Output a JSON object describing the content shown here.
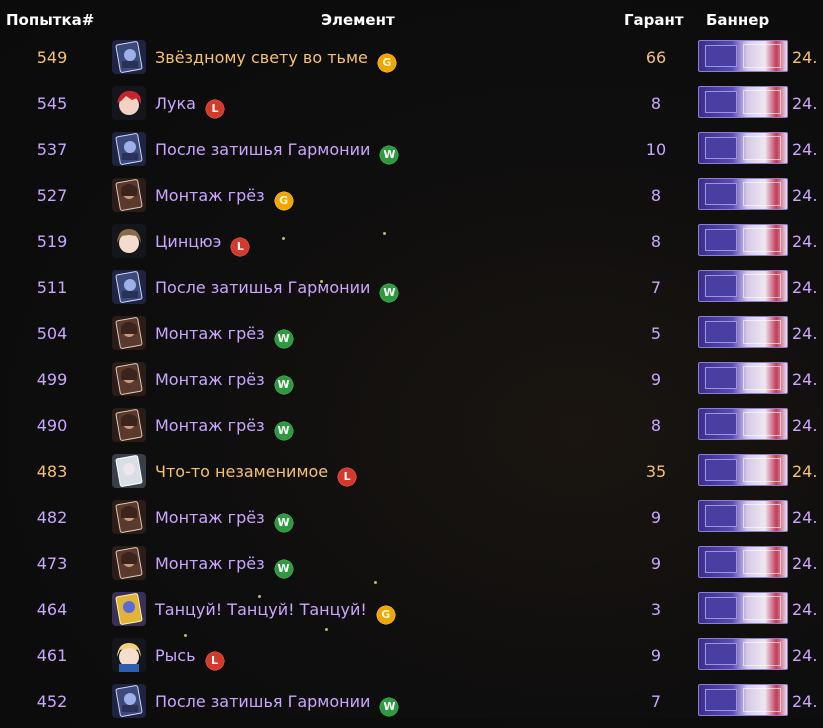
{
  "header": {
    "attempt": "Попытка#",
    "item": "Элемент",
    "pity": "Гарант",
    "banner": "Баннер"
  },
  "rows": [
    {
      "attempt": "549",
      "name": "Звёздному свету во тьме",
      "badge": "G",
      "pity": "66",
      "date": "24.",
      "rarity": "gold",
      "avatar": "lightcone"
    },
    {
      "attempt": "545",
      "name": "Лука",
      "badge": "L",
      "pity": "8",
      "date": "24.",
      "rarity": "purple",
      "avatar": "char-redhair"
    },
    {
      "attempt": "537",
      "name": "После затишья Гармонии",
      "badge": "W",
      "pity": "10",
      "date": "24.",
      "rarity": "purple",
      "avatar": "lightcone"
    },
    {
      "attempt": "527",
      "name": "Монтаж грёз",
      "badge": "G",
      "pity": "8",
      "date": "24.",
      "rarity": "purple",
      "avatar": "lightcone-dark"
    },
    {
      "attempt": "519",
      "name": "Цинцюэ",
      "badge": "L",
      "pity": "8",
      "date": "24.",
      "rarity": "purple",
      "avatar": "char-brown"
    },
    {
      "attempt": "511",
      "name": "После затишья Гармонии",
      "badge": "W",
      "pity": "7",
      "date": "24.",
      "rarity": "purple",
      "avatar": "lightcone"
    },
    {
      "attempt": "504",
      "name": "Монтаж грёз",
      "badge": "W",
      "pity": "5",
      "date": "24.",
      "rarity": "purple",
      "avatar": "lightcone-dark"
    },
    {
      "attempt": "499",
      "name": "Монтаж грёз",
      "badge": "W",
      "pity": "9",
      "date": "24.",
      "rarity": "purple",
      "avatar": "lightcone-dark"
    },
    {
      "attempt": "490",
      "name": "Монтаж грёз",
      "badge": "W",
      "pity": "8",
      "date": "24.",
      "rarity": "purple",
      "avatar": "lightcone-dark"
    },
    {
      "attempt": "483",
      "name": "Что-то незаменимое",
      "badge": "L",
      "pity": "35",
      "date": "24.",
      "rarity": "gold",
      "avatar": "lightcone-light"
    },
    {
      "attempt": "482",
      "name": "Монтаж грёз",
      "badge": "W",
      "pity": "9",
      "date": "24.",
      "rarity": "purple",
      "avatar": "lightcone-dark"
    },
    {
      "attempt": "473",
      "name": "Монтаж грёз",
      "badge": "W",
      "pity": "9",
      "date": "24.",
      "rarity": "purple",
      "avatar": "lightcone-dark"
    },
    {
      "attempt": "464",
      "name": "Танцуй! Танцуй! Танцуй!",
      "badge": "G",
      "pity": "3",
      "date": "24.",
      "rarity": "purple",
      "avatar": "lightcone-gold"
    },
    {
      "attempt": "461",
      "name": "Рысь",
      "badge": "L",
      "pity": "9",
      "date": "24.",
      "rarity": "purple",
      "avatar": "char-blonde"
    },
    {
      "attempt": "452",
      "name": "После затишья Гармонии",
      "badge": "W",
      "pity": "7",
      "date": "24.",
      "rarity": "purple",
      "avatar": "lightcone"
    }
  ],
  "colors": {
    "gold": "#f5c26b",
    "purple": "#c9a7ff",
    "badge_G": "#f0a500",
    "badge_L": "#d33a2c",
    "badge_W": "#2e9a3f"
  }
}
